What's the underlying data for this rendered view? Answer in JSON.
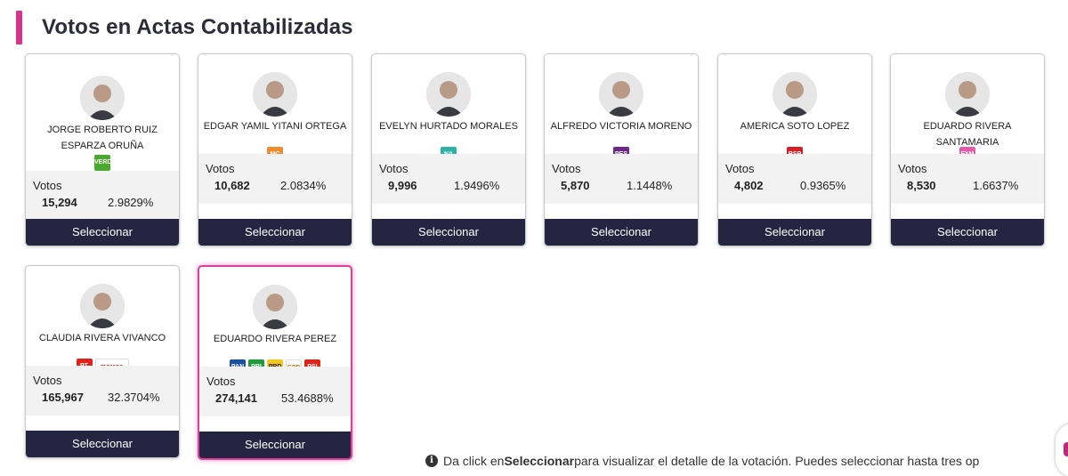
{
  "page": {
    "title": "Votos en Actas Contabilizadas",
    "accent_color": "#d6338a",
    "button_color": "#262541"
  },
  "candidates": [
    {
      "name": "JORGE ROBERTO RUIZ ESPARZA ORUÑA",
      "parties": [
        {
          "label": "VERDE",
          "color": "#4aa82e",
          "icon": "green-party-logo"
        }
      ],
      "votes_label": "Votos",
      "votes": "15,294",
      "percent": "2.9829%",
      "button": "Seleccionar",
      "selected": false
    },
    {
      "name": "EDGAR YAMIL YITANI ORTEGA",
      "parties": [
        {
          "label": "MC",
          "color": "#f28b30",
          "icon": "movimiento-ciudadano-logo"
        }
      ],
      "votes_label": "Votos",
      "votes": "10,682",
      "percent": "2.0834%",
      "button": "Seleccionar",
      "selected": false
    },
    {
      "name": "EVELYN HURTADO MORALES",
      "parties": [
        {
          "label": "NA",
          "color": "#2ab3a6",
          "icon": "nueva-alianza-logo"
        }
      ],
      "votes_label": "Votos",
      "votes": "9,996",
      "percent": "1.9496%",
      "button": "Seleccionar",
      "selected": false
    },
    {
      "name": "ALFREDO VICTORIA MORENO",
      "parties": [
        {
          "label": "PES",
          "color": "#6c2b8a",
          "icon": "pes-logo"
        }
      ],
      "votes_label": "Votos",
      "votes": "5,870",
      "percent": "1.1448%",
      "button": "Seleccionar",
      "selected": false
    },
    {
      "name": "AMERICA SOTO LOPEZ",
      "parties": [
        {
          "label": "RSP",
          "color": "#d32027",
          "icon": "rsp-logo"
        }
      ],
      "votes_label": "Votos",
      "votes": "4,802",
      "percent": "0.9365%",
      "button": "Seleccionar",
      "selected": false
    },
    {
      "name": "EDUARDO RIVERA SANTAMARIA",
      "parties": [
        {
          "label": "FXM",
          "color": "#e55aa6",
          "icon": "fuerza-por-mexico-logo"
        }
      ],
      "votes_label": "Votos",
      "votes": "8,530",
      "percent": "1.6637%",
      "button": "Seleccionar",
      "selected": false
    },
    {
      "name": "CLAUDIA RIVERA VIVANCO",
      "parties": [
        {
          "label": "PT",
          "color": "#e2231a",
          "icon": "pt-logo"
        },
        {
          "label": "morena",
          "color": "#ffffff",
          "text_color": "#b0282e",
          "icon": "morena-logo"
        }
      ],
      "votes_label": "Votos",
      "votes": "165,967",
      "percent": "32.3704%",
      "button": "Seleccionar",
      "selected": false
    },
    {
      "name": "EDUARDO RIVERA PEREZ",
      "parties": [
        {
          "label": "PAN",
          "color": "#1b4fa0",
          "icon": "pan-logo"
        },
        {
          "label": "PRI",
          "color": "#1f9a3a",
          "icon": "pri-logo"
        },
        {
          "label": "PRD",
          "color": "#f3c81b",
          "text_color": "#222",
          "icon": "prd-logo"
        },
        {
          "label": "CPP",
          "color": "#ffffff",
          "text_color": "#e07a1a",
          "icon": "cpp-logo"
        },
        {
          "label": "PSI",
          "color": "#e2231a",
          "icon": "psi-logo"
        }
      ],
      "votes_label": "Votos",
      "votes": "274,141",
      "percent": "53.4688%",
      "button": "Seleccionar",
      "selected": true
    }
  ],
  "footnote": {
    "icon": "info-icon",
    "prefix": "Da click en ",
    "bold": "Seleccionar",
    "suffix": " para visualizar el detalle de la votación. Puedes seleccionar hasta tres op"
  }
}
